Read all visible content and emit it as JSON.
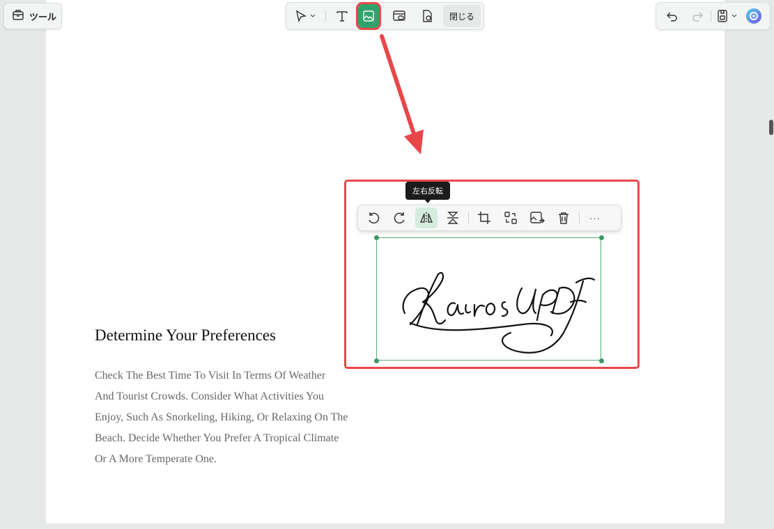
{
  "topbar": {
    "tools_label": "ツール",
    "close_label": "閉じる"
  },
  "tooltip": "左右反転",
  "content": {
    "heading": "Determine Your Preferences",
    "lines": [
      "Check The Best Time To Visit In Terms Of Weather",
      "And Tourist Crowds. Consider What Activities You",
      "Enjoy, Such As Snorkeling, Hiking, Or Relaxing On The",
      "Beach. Decide Whether You Prefer A Tropical Climate",
      "Or A More Temperate One."
    ]
  },
  "signature_text": "Kairos UPDF",
  "image_toolbar": {
    "more_label": "···"
  },
  "colors": {
    "accent_green": "#2fa36b",
    "highlight_red": "#e8474a",
    "page_bg": "#e6e9e7"
  },
  "icons": [
    "toolbox-icon",
    "cursor-icon",
    "chevron-down-icon",
    "text-icon",
    "image-icon",
    "link-icon",
    "page-settings-icon",
    "undo-icon",
    "redo-icon",
    "save-icon",
    "ai-assistant-icon",
    "rotate-left-icon",
    "rotate-right-icon",
    "flip-horizontal-icon",
    "flip-vertical-icon",
    "crop-icon",
    "replace-icon",
    "extract-icon",
    "delete-icon",
    "more-icon"
  ]
}
